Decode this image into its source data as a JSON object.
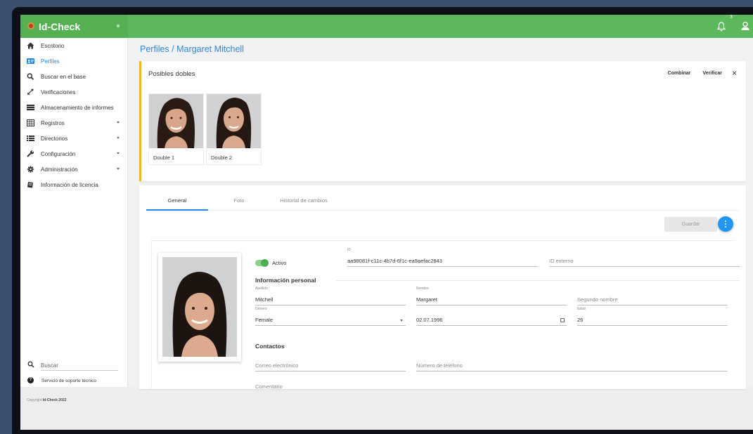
{
  "app": {
    "name": "Id-Check",
    "notification_count": "3"
  },
  "sidebar": {
    "items": [
      {
        "label": "Escritorio",
        "icon": "home-icon"
      },
      {
        "label": "Perfiles",
        "icon": "id-card-icon",
        "active": true
      },
      {
        "label": "Buscar en el base",
        "icon": "search-icon"
      },
      {
        "label": "Verificaciones",
        "icon": "expand-arrows-icon"
      },
      {
        "label": "Almacenamiento de informes",
        "icon": "storage-icon"
      },
      {
        "label": "Registros",
        "icon": "table-icon",
        "expandable": true
      },
      {
        "label": "Directorios",
        "icon": "list-icon",
        "expandable": true
      },
      {
        "label": "Configuración",
        "icon": "wrench-icon",
        "expandable": true
      },
      {
        "label": "Administración",
        "icon": "gear-icon",
        "expandable": true
      },
      {
        "label": "Información de licencia",
        "icon": "license-icon"
      }
    ],
    "search_placeholder": "Buscar",
    "support_label": "Servicio de soporte técnico",
    "copyright_prefix": "Copyright",
    "copyright_brand": "Id-Check 2022"
  },
  "breadcrumb": "Perfiles / Margaret Mitchell",
  "duplicates": {
    "title": "Posibles dobles",
    "combine_label": "Combinar",
    "verify_label": "Verificar",
    "items": [
      {
        "label": "Double 1"
      },
      {
        "label": "Double 2"
      }
    ]
  },
  "tabs": [
    {
      "label": "General",
      "active": true
    },
    {
      "label": "Foto"
    },
    {
      "label": "Historial de cambios"
    }
  ],
  "save_label": "Guardar",
  "profile": {
    "active_label": "Activo",
    "id_label": "ID",
    "id_value": "aa98081f-c11c-4b7d-6f1c-ea9aefac2843",
    "external_id_placeholder": "ID externo",
    "personal_section": "Información personal",
    "surname_label": "Apellido",
    "surname_value": "Mitchell",
    "name_label": "Nombre",
    "name_value": "Margaret",
    "middle_name_placeholder": "Segundo nombre",
    "gender_label": "Género",
    "gender_value": "Female",
    "birthdate_value": "02.07.1996",
    "age_label": "Edad",
    "age_value": "26",
    "contacts_section": "Contactos",
    "email_placeholder": "Correo electrónico",
    "phone_placeholder": "Número de teléfono",
    "comment_placeholder": "Comentario"
  },
  "colors": {
    "topbar": "#5cb85c",
    "accent": "#1e88e5",
    "duplicate_border": "#f0b429",
    "toggle": "#4caf50"
  }
}
